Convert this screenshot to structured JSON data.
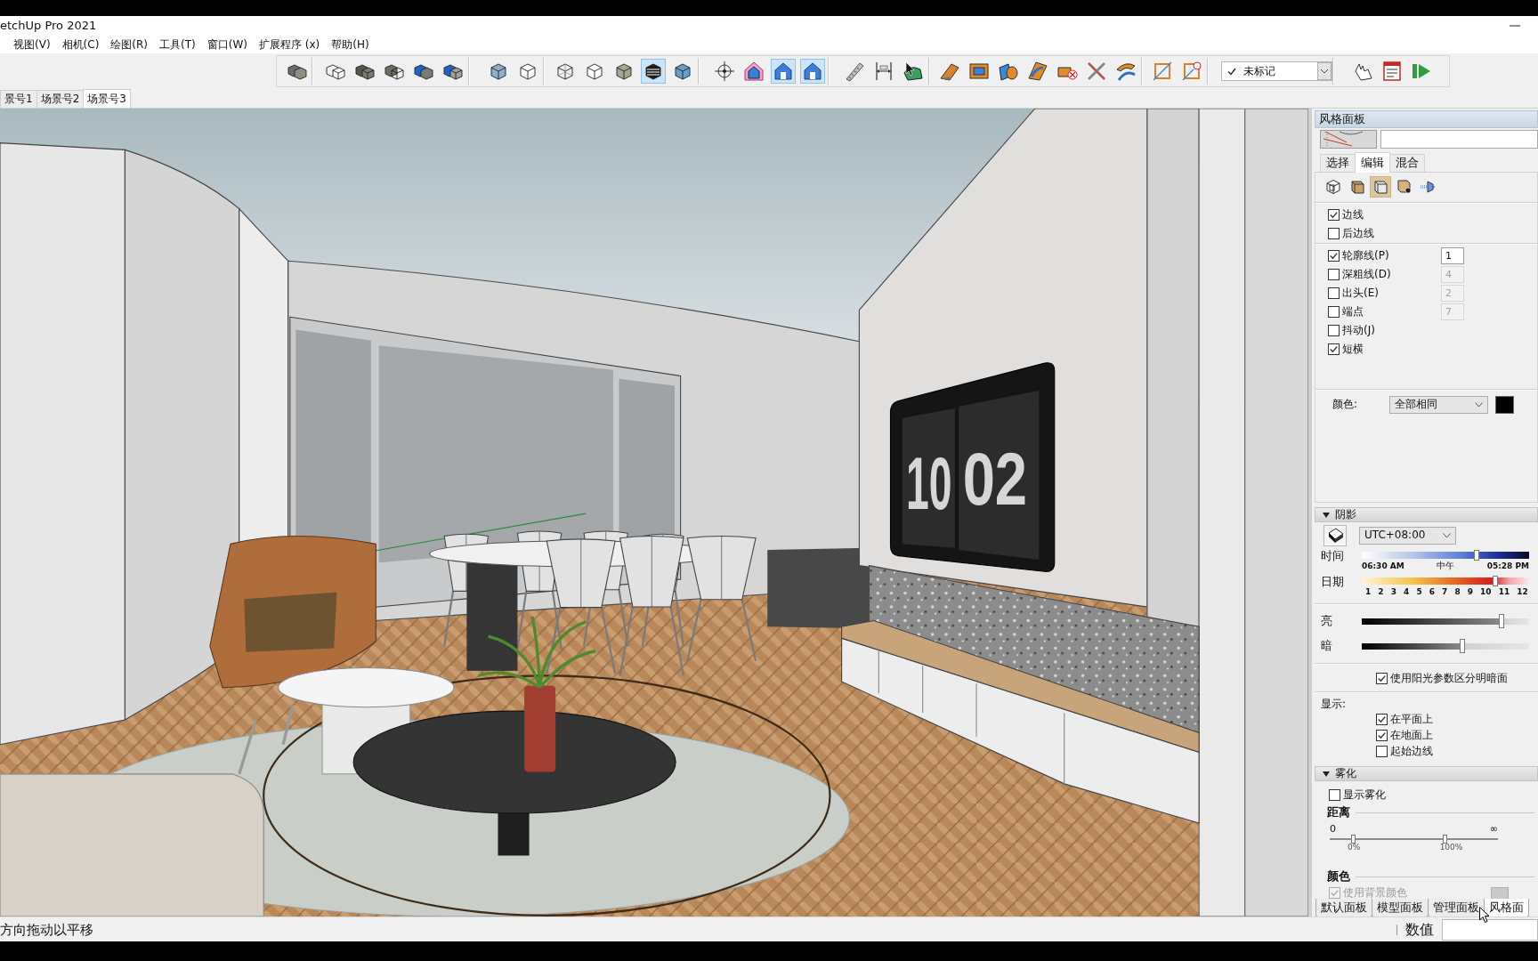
{
  "window": {
    "title": "etchUp Pro 2021"
  },
  "menu": [
    "视图(V)",
    "相机(C)",
    "绘图(R)",
    "工具(T)",
    "窗口(W)",
    "扩展程序 (x)",
    "帮助(H)"
  ],
  "toolbar": {
    "groups": [
      {
        "kind": "buttons",
        "buttons": [
          {
            "selected": false
          }
        ]
      },
      {
        "kind": "buttons",
        "buttons": [
          {
            "selected": false
          },
          {
            "selected": false
          },
          {
            "selected": false
          },
          {
            "selected": false
          },
          {
            "selected": false
          }
        ]
      },
      {
        "kind": "buttons",
        "buttons": [
          {
            "selected": false
          },
          {
            "selected": false
          }
        ]
      },
      {
        "kind": "buttons",
        "buttons": [
          {
            "selected": false
          },
          {
            "selected": false
          },
          {
            "selected": false
          },
          {
            "selected": true
          },
          {
            "selected": false
          }
        ]
      },
      {
        "kind": "buttons",
        "buttons": [
          {
            "selected": false
          },
          {
            "selected": false
          },
          {
            "selected": true
          },
          {
            "selected": true
          }
        ]
      },
      {
        "kind": "buttons",
        "buttons": [
          {
            "selected": false
          },
          {
            "selected": false
          },
          {
            "selected": false
          }
        ]
      },
      {
        "kind": "buttons",
        "buttons": [
          {
            "selected": false
          },
          {
            "selected": false
          },
          {
            "selected": false
          },
          {
            "selected": false
          },
          {
            "selected": false
          },
          {
            "selected": false
          },
          {
            "selected": false
          }
        ]
      },
      {
        "kind": "buttons",
        "buttons": [
          {
            "selected": false
          },
          {
            "selected": false
          }
        ]
      },
      {
        "kind": "dropdown",
        "value": "未标记",
        "checked": true
      },
      {
        "kind": "buttons",
        "buttons": [
          {
            "selected": false
          },
          {
            "selected": false
          },
          {
            "selected": false
          }
        ]
      }
    ]
  },
  "scene_tabs": [
    {
      "label": "景号1",
      "selected": false
    },
    {
      "label": "场景号2",
      "selected": false
    },
    {
      "label": "场景号3",
      "selected": true
    }
  ],
  "viewport": {
    "clock": {
      "hours": "10",
      "minutes": "02"
    }
  },
  "styles_panel": {
    "title": "风格面板",
    "tabs": [
      {
        "label": "选择",
        "selected": false
      },
      {
        "label": "编辑",
        "selected": true
      },
      {
        "label": "混合",
        "selected": false
      }
    ],
    "edit_modes": [
      {
        "selected": false
      },
      {
        "selected": false
      },
      {
        "selected": true
      },
      {
        "selected": false
      },
      {
        "selected": false
      }
    ],
    "edge_options": [
      {
        "label": "边线",
        "checked": true
      },
      {
        "label": "后边线",
        "checked": false
      }
    ],
    "edge_effects": [
      {
        "label": "轮廓线(P)",
        "checked": true,
        "value": "1"
      },
      {
        "label": "深粗线(D)",
        "checked": false,
        "value": "4"
      },
      {
        "label": "出头(E)",
        "checked": false,
        "value": "2"
      },
      {
        "label": "端点",
        "checked": false,
        "value": "7"
      },
      {
        "label": "抖动(J)",
        "checked": false
      },
      {
        "label": "短横",
        "checked": true
      }
    ],
    "color": {
      "label": "颜色:",
      "value": "全部相同"
    }
  },
  "shadows": {
    "title": "阴影",
    "expanded": true,
    "timezone": "UTC+08:00",
    "time": {
      "label": "时间",
      "level": 0.686,
      "start": "06:30 AM",
      "middle": "中午",
      "end": "05:28 PM"
    },
    "date": {
      "label": "日期",
      "level": 0.8,
      "ticks": [
        "1",
        "2",
        "3",
        "4",
        "5",
        "6",
        "7",
        "8",
        "9",
        "10",
        "11",
        "12"
      ]
    },
    "light": {
      "label": "亮",
      "level": 0.835
    },
    "dark": {
      "label": "暗",
      "level": 0.6
    },
    "use_sun": {
      "label": "使用阳光参数区分明暗面",
      "checked": true
    },
    "display_label": "显示:",
    "display_options": [
      {
        "label": "在平面上",
        "checked": true
      },
      {
        "label": "在地面上",
        "checked": true
      },
      {
        "label": "起始边线",
        "checked": false
      }
    ]
  },
  "fog": {
    "title": "雾化",
    "expanded": true,
    "show": {
      "label": "显示雾化",
      "checked": false
    },
    "distance_label": "距离",
    "distance_min": "0",
    "distance_max": "∞",
    "thumbs": [
      {
        "level": 0.138,
        "label": "0%"
      },
      {
        "level": 0.686,
        "label": "100%"
      }
    ],
    "color_label": "颜色",
    "use_background": {
      "label": "使用背景颜色",
      "checked": true,
      "disabled": true
    }
  },
  "panel_tabs": [
    {
      "label": "默认面板",
      "selected": false
    },
    {
      "label": "模型面板",
      "selected": false
    },
    {
      "label": "管理面板",
      "selected": false
    },
    {
      "label": "风格面",
      "selected": true
    }
  ],
  "status_bar": {
    "hint": "方向拖动以平移",
    "measurements_label": "数值"
  }
}
